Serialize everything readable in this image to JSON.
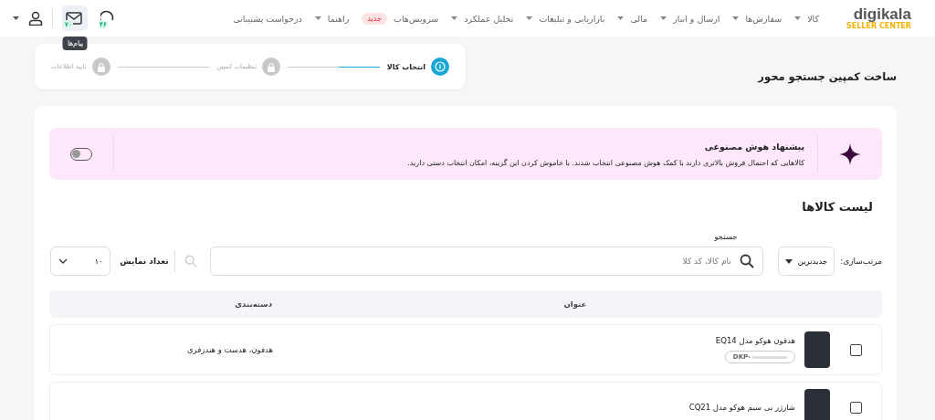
{
  "header": {
    "logo": "digikala",
    "logo_sub": "SELLER CENTER",
    "nav": [
      {
        "label": "کالا",
        "has_menu": true
      },
      {
        "label": "سفارش‌ها",
        "has_menu": true
      },
      {
        "label": "ارسال و انبار",
        "has_menu": true
      },
      {
        "label": "مالی",
        "has_menu": true
      },
      {
        "label": "بازاریابی و تبلیغات",
        "has_menu": true
      },
      {
        "label": "تحلیل عملکرد",
        "has_menu": true
      },
      {
        "label": "سرویس‌هاب",
        "has_menu": false,
        "badge": "جدید"
      },
      {
        "label": "راهنما",
        "has_menu": true
      },
      {
        "label": "درخواست پشتیبانی",
        "has_menu": false
      }
    ],
    "support_count": "۴۶",
    "messages_count": "۷۰",
    "messages_tooltip": "پیام‌ها"
  },
  "page_title": "ساخت کمپین جستجو محور",
  "steps": [
    {
      "label": "انتخاب کالا",
      "active": true
    },
    {
      "label": "تنظیمات کمپین",
      "active": false
    },
    {
      "label": "تایید اطلاعات",
      "active": false
    }
  ],
  "ai": {
    "title": "پیشنهاد هوش مصنوعی",
    "text": "کالاهایی که احتمال فروش بالاتری دارند با کمک هوش مصنوعی انتخاب شدند. با خاموش کردن این گزینه، امکان انتخاب دستی دارید.",
    "on": false
  },
  "list_title": "لیست کالاها",
  "filters": {
    "sort_label": "مرتب‌سازی:",
    "sort_value": "جدیدترین",
    "search_label": "جستجو",
    "search_placeholder": "نام کالا، کد کلا",
    "count_label": "تعداد نمایش",
    "count_value": "۱۰"
  },
  "table": {
    "columns": [
      "عنوان",
      "دسته‌بندی"
    ],
    "rows": [
      {
        "title": "هدفون هوکو مدل EQ14",
        "code": "DKP-",
        "category": "هدفون، هدست و هندزفری",
        "checked": false
      },
      {
        "title": "شارژر بی سیم هوکو مدل CQ21",
        "checked": false
      }
    ]
  }
}
